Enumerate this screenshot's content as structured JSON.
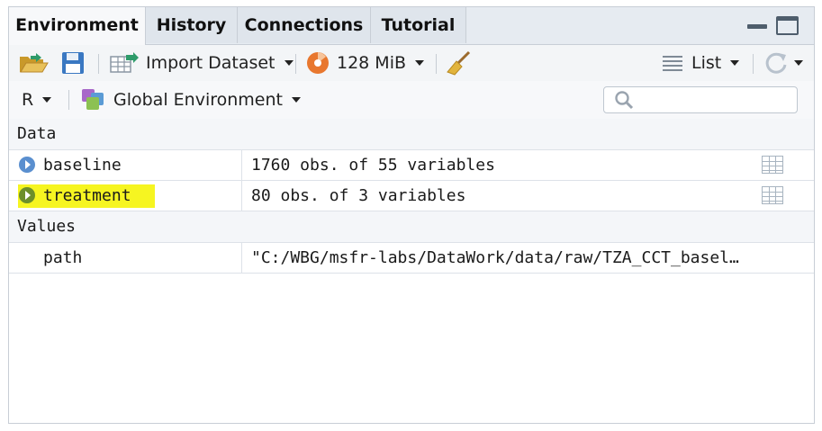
{
  "tabs": [
    {
      "label": "Environment",
      "active": true
    },
    {
      "label": "History",
      "active": false
    },
    {
      "label": "Connections",
      "active": false
    },
    {
      "label": "Tutorial",
      "active": false
    }
  ],
  "toolbar": {
    "import_label": "Import Dataset",
    "memory_label": "128 MiB",
    "view_mode_label": "List"
  },
  "toolbar2": {
    "language_label": "R",
    "environment_label": "Global Environment",
    "search_placeholder": ""
  },
  "sections": {
    "data_label": "Data",
    "values_label": "Values"
  },
  "data_rows": [
    {
      "name": "baseline",
      "value": "1760 obs. of 55 variables",
      "highlighted": false
    },
    {
      "name": "treatment",
      "value": "80 obs. of 3 variables",
      "highlighted": true
    }
  ],
  "value_rows": [
    {
      "name": "path",
      "value": "\"C:/WBG/msfr-labs/DataWork/data/raw/TZA_CCT_basel…"
    }
  ],
  "colors": {
    "highlight": "#f6f521",
    "expand_blue": "#5a8fcf",
    "expand_green": "#6d8f2a",
    "memory_orange": "#e8772e"
  },
  "icons": [
    "open-folder-icon",
    "save-icon",
    "import-dataset-icon",
    "memory-pie-icon",
    "broom-icon",
    "list-icon",
    "refresh-icon",
    "r-language-icon",
    "global-environment-icon",
    "search-icon",
    "expand-icon",
    "table-view-icon",
    "minimize-icon",
    "maximize-icon"
  ]
}
